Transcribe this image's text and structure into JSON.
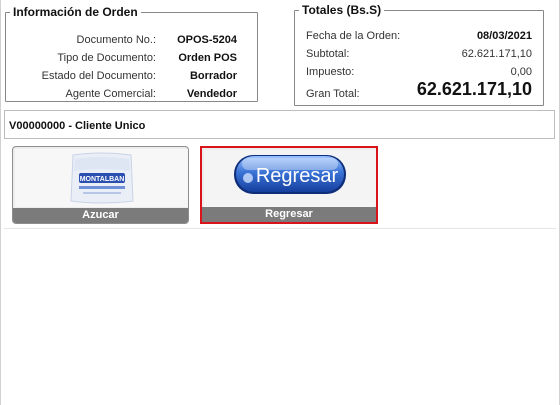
{
  "order_info": {
    "legend": "Información de Orden",
    "fields": [
      {
        "label": "Documento No.:",
        "value": "OPOS-5204"
      },
      {
        "label": "Tipo de Documento:",
        "value": "Orden POS"
      },
      {
        "label": "Estado del Documento:",
        "value": "Borrador"
      },
      {
        "label": "Agente Comercial:",
        "value": "Vendedor"
      }
    ]
  },
  "totals": {
    "legend": "Totales (Bs.S)",
    "fields": [
      {
        "label": "Fecha de la Orden:",
        "value": "08/03/2021"
      },
      {
        "label": "Subtotal:",
        "value": "62.621.171,10"
      },
      {
        "label": "Impuesto:",
        "value": "0,00"
      },
      {
        "label": "Gran Total:",
        "value": "62.621.171,10"
      }
    ]
  },
  "customer": {
    "text": "V00000000 - Cliente Unico"
  },
  "tiles": [
    {
      "label": "Azucar",
      "image_text": "MONTALBAN"
    },
    {
      "label": "Regresar",
      "image_text": "Regresar"
    }
  ],
  "colors": {
    "selected_border": "#d8141a",
    "tile_label_bg": "#7b7b7b",
    "button_blue": "#2f63c9"
  }
}
